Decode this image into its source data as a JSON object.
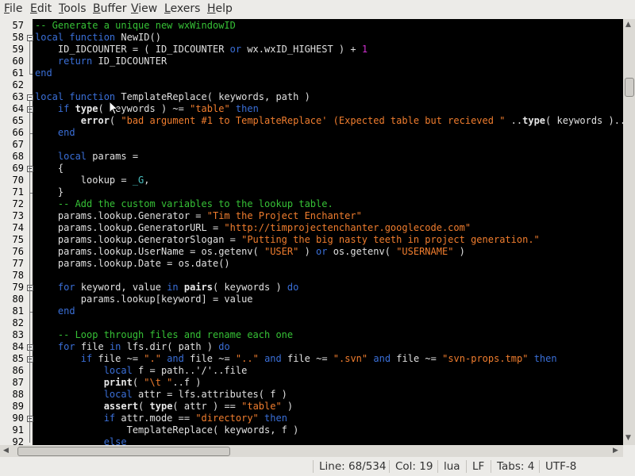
{
  "menu": [
    {
      "label": "File",
      "key": "F",
      "rest": "ile"
    },
    {
      "label": "Edit",
      "key": "E",
      "rest": "dit"
    },
    {
      "label": "Tools",
      "key": "T",
      "rest": "ools"
    },
    {
      "label": "Buffer",
      "key": "B",
      "rest": "uffer"
    },
    {
      "label": "View",
      "key": "V",
      "rest": "iew"
    },
    {
      "label": "Lexers",
      "key": "L",
      "rest": "exers"
    },
    {
      "label": "Help",
      "key": "H",
      "rest": "elp"
    }
  ],
  "colors": {
    "background": "#000000",
    "keyword": "#3a6fd8",
    "string": "#f07d2e",
    "comment": "#36c136",
    "number": "#d030d0",
    "global": "#4ac0c0",
    "default": "#e0e0e0"
  },
  "lines": [
    {
      "n": "57",
      "t": [
        [
          "cmt",
          "-- Generate a unique new wxWindowID"
        ]
      ]
    },
    {
      "n": "58",
      "fold": "open",
      "t": [
        [
          "kw",
          "local function"
        ],
        [
          "d",
          " NewID()"
        ]
      ]
    },
    {
      "n": "59",
      "t": [
        [
          "d",
          "    ID_IDCOUNTER = ( ID_IDCOUNTER "
        ],
        [
          "kw",
          "or"
        ],
        [
          "d",
          " wx.wxID_HIGHEST ) + "
        ],
        [
          "num",
          "1"
        ]
      ]
    },
    {
      "n": "60",
      "t": [
        [
          "d",
          "    "
        ],
        [
          "kw",
          "return"
        ],
        [
          "d",
          " ID_IDCOUNTER"
        ]
      ]
    },
    {
      "n": "61",
      "foldend": true,
      "t": [
        [
          "kw",
          "end"
        ]
      ]
    },
    {
      "n": "62",
      "t": []
    },
    {
      "n": "63",
      "fold": "open",
      "t": [
        [
          "kw",
          "local function"
        ],
        [
          "d",
          " TemplateReplace( keywords, path )"
        ]
      ]
    },
    {
      "n": "64",
      "fold": "open",
      "t": [
        [
          "d",
          "    "
        ],
        [
          "kw",
          "if"
        ],
        [
          "d",
          " "
        ],
        [
          "bk",
          "type"
        ],
        [
          "d",
          "( keywords ) ~= "
        ],
        [
          "str",
          "\"table\""
        ],
        [
          "d",
          " "
        ],
        [
          "kw",
          "then"
        ]
      ]
    },
    {
      "n": "65",
      "t": [
        [
          "d",
          "        "
        ],
        [
          "bk",
          "error"
        ],
        [
          "d",
          "( "
        ],
        [
          "str",
          "\"bad argument #1 to TemplateReplace' (Expected table but recieved \""
        ],
        [
          "d",
          " .."
        ],
        [
          "bk",
          "type"
        ],
        [
          "d",
          "( keywords ).."
        ],
        [
          "str",
          "\")\""
        ]
      ]
    },
    {
      "n": "66",
      "foldend": true,
      "t": [
        [
          "d",
          "    "
        ],
        [
          "kw",
          "end"
        ]
      ]
    },
    {
      "n": "67",
      "t": []
    },
    {
      "n": "68",
      "t": [
        [
          "d",
          "    "
        ],
        [
          "kw",
          "local"
        ],
        [
          "d",
          " params ="
        ]
      ]
    },
    {
      "n": "69",
      "fold": "open",
      "t": [
        [
          "d",
          "    {"
        ]
      ]
    },
    {
      "n": "70",
      "t": [
        [
          "d",
          "        lookup = "
        ],
        [
          "glob",
          "_G"
        ],
        [
          "d",
          ","
        ]
      ]
    },
    {
      "n": "71",
      "foldend": true,
      "t": [
        [
          "d",
          "    }"
        ]
      ]
    },
    {
      "n": "72",
      "t": [
        [
          "d",
          "    "
        ],
        [
          "cmt",
          "-- Add the custom variables to the lookup table."
        ]
      ]
    },
    {
      "n": "73",
      "t": [
        [
          "d",
          "    params.lookup.Generator = "
        ],
        [
          "str",
          "\"Tim the Project Enchanter\""
        ]
      ]
    },
    {
      "n": "74",
      "t": [
        [
          "d",
          "    params.lookup.GeneratorURL = "
        ],
        [
          "str",
          "\"http://timprojectenchanter.googlecode.com\""
        ]
      ]
    },
    {
      "n": "75",
      "t": [
        [
          "d",
          "    params.lookup.GeneratorSlogan = "
        ],
        [
          "str",
          "\"Putting the big nasty teeth in project generation.\""
        ]
      ]
    },
    {
      "n": "76",
      "t": [
        [
          "d",
          "    params.lookup.UserName = os.getenv( "
        ],
        [
          "str",
          "\"USER\""
        ],
        [
          "d",
          " ) "
        ],
        [
          "kw",
          "or"
        ],
        [
          "d",
          " os.getenv( "
        ],
        [
          "str",
          "\"USERNAME\""
        ],
        [
          "d",
          " )"
        ]
      ]
    },
    {
      "n": "77",
      "t": [
        [
          "d",
          "    params.lookup.Date = os.date()"
        ]
      ]
    },
    {
      "n": "78",
      "t": []
    },
    {
      "n": "79",
      "fold": "open",
      "t": [
        [
          "d",
          "    "
        ],
        [
          "kw",
          "for"
        ],
        [
          "d",
          " keyword, value "
        ],
        [
          "kw",
          "in"
        ],
        [
          "d",
          " "
        ],
        [
          "bk",
          "pairs"
        ],
        [
          "d",
          "( keywords ) "
        ],
        [
          "kw",
          "do"
        ]
      ]
    },
    {
      "n": "80",
      "t": [
        [
          "d",
          "        params.lookup[keyword] = value"
        ]
      ]
    },
    {
      "n": "81",
      "foldend": true,
      "t": [
        [
          "d",
          "    "
        ],
        [
          "kw",
          "end"
        ]
      ]
    },
    {
      "n": "82",
      "t": []
    },
    {
      "n": "83",
      "t": [
        [
          "d",
          "    "
        ],
        [
          "cmt",
          "-- Loop through files and rename each one"
        ]
      ]
    },
    {
      "n": "84",
      "fold": "open",
      "t": [
        [
          "d",
          "    "
        ],
        [
          "kw",
          "for"
        ],
        [
          "d",
          " file "
        ],
        [
          "kw",
          "in"
        ],
        [
          "d",
          " lfs.dir( path ) "
        ],
        [
          "kw",
          "do"
        ]
      ]
    },
    {
      "n": "85",
      "fold": "open",
      "t": [
        [
          "d",
          "        "
        ],
        [
          "kw",
          "if"
        ],
        [
          "d",
          " file ~= "
        ],
        [
          "str",
          "\".\""
        ],
        [
          "d",
          " "
        ],
        [
          "kw",
          "and"
        ],
        [
          "d",
          " file ~= "
        ],
        [
          "str",
          "\"..\""
        ],
        [
          "d",
          " "
        ],
        [
          "kw",
          "and"
        ],
        [
          "d",
          " file ~= "
        ],
        [
          "str",
          "\".svn\""
        ],
        [
          "d",
          " "
        ],
        [
          "kw",
          "and"
        ],
        [
          "d",
          " file ~= "
        ],
        [
          "str",
          "\"svn-props.tmp\""
        ],
        [
          "d",
          " "
        ],
        [
          "kw",
          "then"
        ]
      ]
    },
    {
      "n": "86",
      "t": [
        [
          "d",
          "            "
        ],
        [
          "kw",
          "local"
        ],
        [
          "d",
          " f = path..'/'..file"
        ]
      ]
    },
    {
      "n": "87",
      "t": [
        [
          "d",
          "            "
        ],
        [
          "bk",
          "print"
        ],
        [
          "d",
          "( "
        ],
        [
          "str",
          "\"\\t \""
        ],
        [
          "d",
          "..f )"
        ]
      ]
    },
    {
      "n": "88",
      "t": [
        [
          "d",
          "            "
        ],
        [
          "kw",
          "local"
        ],
        [
          "d",
          " attr = lfs.attributes( f )"
        ]
      ]
    },
    {
      "n": "89",
      "t": [
        [
          "d",
          "            "
        ],
        [
          "bk",
          "assert"
        ],
        [
          "d",
          "( "
        ],
        [
          "bk",
          "type"
        ],
        [
          "d",
          "( attr ) == "
        ],
        [
          "str",
          "\"table\""
        ],
        [
          "d",
          " )"
        ]
      ]
    },
    {
      "n": "90",
      "fold": "open",
      "t": [
        [
          "d",
          "            "
        ],
        [
          "kw",
          "if"
        ],
        [
          "d",
          " attr.mode == "
        ],
        [
          "str",
          "\"directory\""
        ],
        [
          "d",
          " "
        ],
        [
          "kw",
          "then"
        ]
      ]
    },
    {
      "n": "91",
      "t": [
        [
          "d",
          "                TemplateReplace( keywords, f )"
        ]
      ]
    },
    {
      "n": "92",
      "t": [
        [
          "d",
          "            "
        ],
        [
          "kw",
          "else"
        ]
      ]
    }
  ],
  "status": {
    "line": "Line: 68/534",
    "col": "Col: 19",
    "lexer": "lua",
    "eol": "LF",
    "tabs": "Tabs: 4",
    "encoding": "UTF-8"
  },
  "scroll": {
    "vertical_position": 0.13,
    "horizontal_fraction": 0.34
  }
}
